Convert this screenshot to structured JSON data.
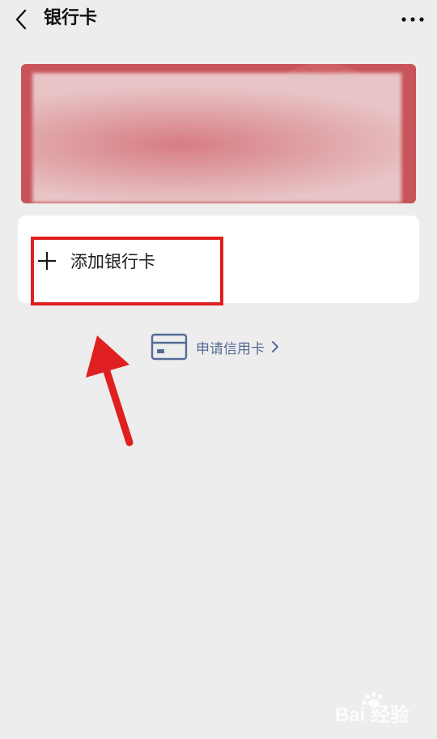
{
  "header": {
    "title": "银行卡",
    "back_icon": "chevron-left-icon",
    "more_icon": "more-dots-icon"
  },
  "card": {
    "brand_color": "#c9535a"
  },
  "add_card": {
    "label": "添加银行卡",
    "icon": "plus-icon"
  },
  "apply_credit": {
    "label": "申请信用卡",
    "icon": "credit-card-icon",
    "color": "#576b95"
  },
  "annotation": {
    "color": "#e02020"
  },
  "watermark": {
    "text": "Bai 经验"
  }
}
